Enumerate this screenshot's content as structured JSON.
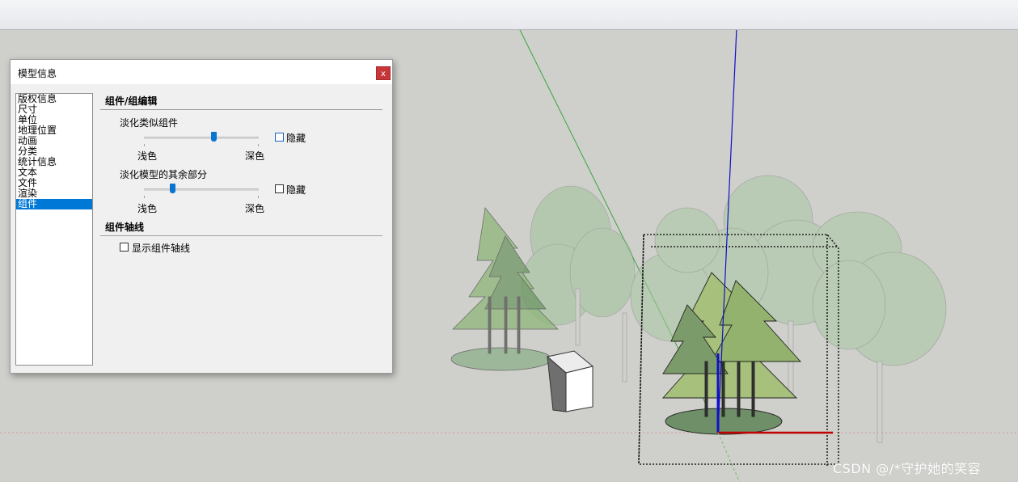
{
  "watermark": "CSDN @/*守护她的笑容",
  "dialog": {
    "title": "模型信息",
    "close_label": "x",
    "categories": [
      "版权信息",
      "尺寸",
      "单位",
      "地理位置",
      "动画",
      "分类",
      "统计信息",
      "文本",
      "文件",
      "渲染",
      "组件"
    ],
    "selected_category": "组件",
    "section_edit": {
      "title": "组件/组编辑",
      "fade_similar": {
        "label": "淡化类似组件",
        "value_fraction": 0.61,
        "min_label": "浅色",
        "max_label": "深色",
        "hide_label": "隐藏",
        "hide_checked": false
      },
      "fade_rest": {
        "label": "淡化模型的其余部分",
        "value_fraction": 0.25,
        "min_label": "浅色",
        "max_label": "深色",
        "hide_label": "隐藏",
        "hide_checked": false
      }
    },
    "section_axes": {
      "title": "组件轴线",
      "show_axes_label": "显示组件轴线",
      "show_axes_checked": false
    }
  },
  "colors": {
    "accent": "#0078d7",
    "close": "#c7373a",
    "axis_red": "#c00000",
    "axis_green": "#3aa63a",
    "axis_blue": "#1010c8"
  }
}
